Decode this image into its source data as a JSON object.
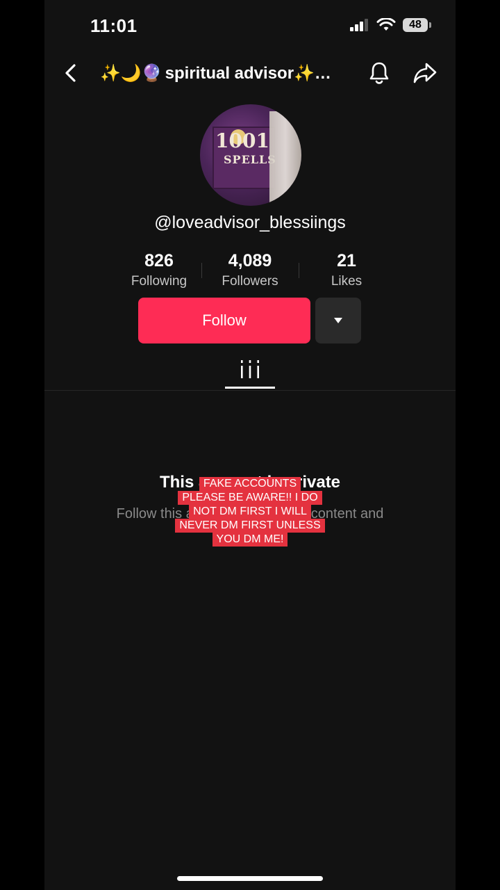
{
  "status_bar": {
    "time": "11:01",
    "battery": "48",
    "icons": [
      "cellular-signal-icon",
      "wifi-icon",
      "battery-icon"
    ]
  },
  "header": {
    "title_emoji": "✨🌙🔮",
    "title": "spiritual advisor✨…",
    "icons": [
      "back-chevron-icon",
      "bell-icon",
      "share-arrow-icon"
    ]
  },
  "profile": {
    "avatar_text": {
      "number": "1001",
      "word": "SPELLS"
    },
    "username": "@loveadvisor_blessiings",
    "stats": [
      {
        "value": "826",
        "label": "Following"
      },
      {
        "value": "4,089",
        "label": "Followers"
      },
      {
        "value": "21",
        "label": "Likes"
      }
    ],
    "follow_label": "Follow",
    "more_icon": "caret-down-icon"
  },
  "tabs": {
    "active_icon": "grid-videos-icon"
  },
  "private": {
    "title": "This account is private",
    "subtitle": "Follow this account to see their content and"
  },
  "caption_overlay": {
    "lines": [
      "FAKE ACCOUNTS",
      "PLEASE BE AWARE!! I DO",
      "NOT DM FIRST I WILL",
      "NEVER DM FIRST UNLESS",
      "YOU DM ME!"
    ],
    "color": "#e4323f"
  },
  "colors": {
    "accent": "#fe2c55",
    "background": "#121212"
  }
}
